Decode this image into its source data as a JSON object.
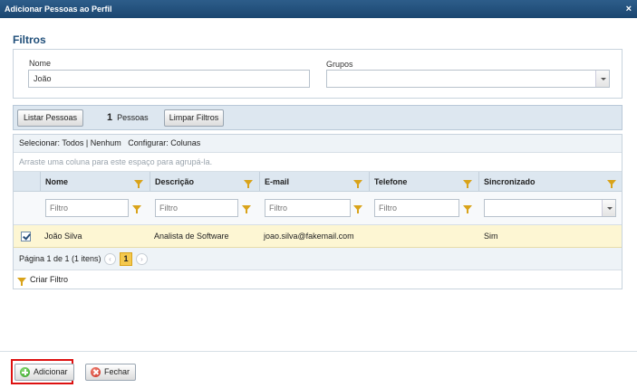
{
  "window": {
    "title": "Adicionar Pessoas ao Perfil",
    "close_glyph": "×"
  },
  "filters": {
    "section_title": "Filtros",
    "nome_label": "Nome",
    "nome_value": "João",
    "grupos_label": "Grupos",
    "grupos_value": ""
  },
  "toolbar": {
    "list_button": "Listar Pessoas",
    "count_number": "1",
    "count_label": "Pessoas",
    "clear_button": "Limpar Filtros"
  },
  "grid": {
    "select_text": "Selecionar: Todos | Nenhum",
    "configure_text": "Configurar: Colunas",
    "group_hint": "Arraste uma coluna para este espaço para agrupá-la.",
    "columns": [
      "Nome",
      "Descrição",
      "E-mail",
      "Telefone",
      "Sincronizado"
    ],
    "filter_placeholder": "Filtro",
    "rows": [
      {
        "checked": true,
        "nome": "João Silva",
        "descricao": "Analista de Software",
        "email": "joao.silva@fakemail.com",
        "telefone": "",
        "sincronizado": "Sim"
      }
    ],
    "pager_text": "Página 1 de 1 (1 itens)",
    "current_page": "1",
    "prev_glyph": "‹",
    "next_glyph": "›",
    "create_filter": "Criar Filtro"
  },
  "footer": {
    "add_button": "Adicionar",
    "close_button": "Fechar"
  },
  "colors": {
    "titlebar": "#1b4670",
    "highlight": "#dd1111",
    "selected_row": "#fdf6d3",
    "funnel": "#d9a31a"
  }
}
